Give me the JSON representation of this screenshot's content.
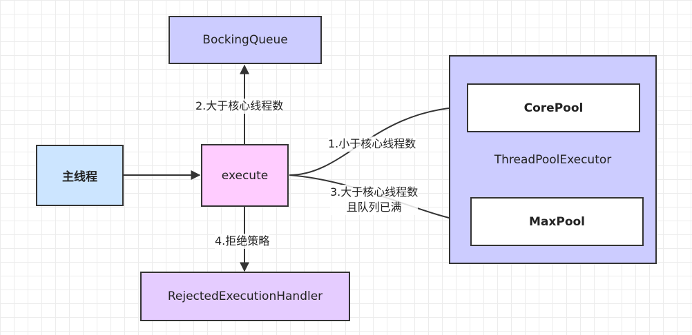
{
  "nodes": {
    "main_thread": "主线程",
    "execute": "execute",
    "blocking_queue": "BockingQueue",
    "rejected_handler": "RejectedExecutionHandler",
    "thread_pool_executor": "ThreadPoolExecutor",
    "core_pool": "CorePool",
    "max_pool": "MaxPool"
  },
  "edges": {
    "less_than_core": "1.小于核心线程数",
    "greater_than_core": "2.大于核心线程数",
    "greater_and_full_line1": "3.大于核心线程数",
    "greater_and_full_line2": "且队列已满",
    "reject_policy": "4.拒绝策略"
  },
  "colors": {
    "main_thread_fill": "#cce5ff",
    "execute_fill": "#ffccff",
    "queue_fill": "#ccccff",
    "handler_fill": "#e5ccff",
    "executor_fill": "#ccccff",
    "pool_fill": "#ffffff",
    "stroke": "#333333"
  }
}
